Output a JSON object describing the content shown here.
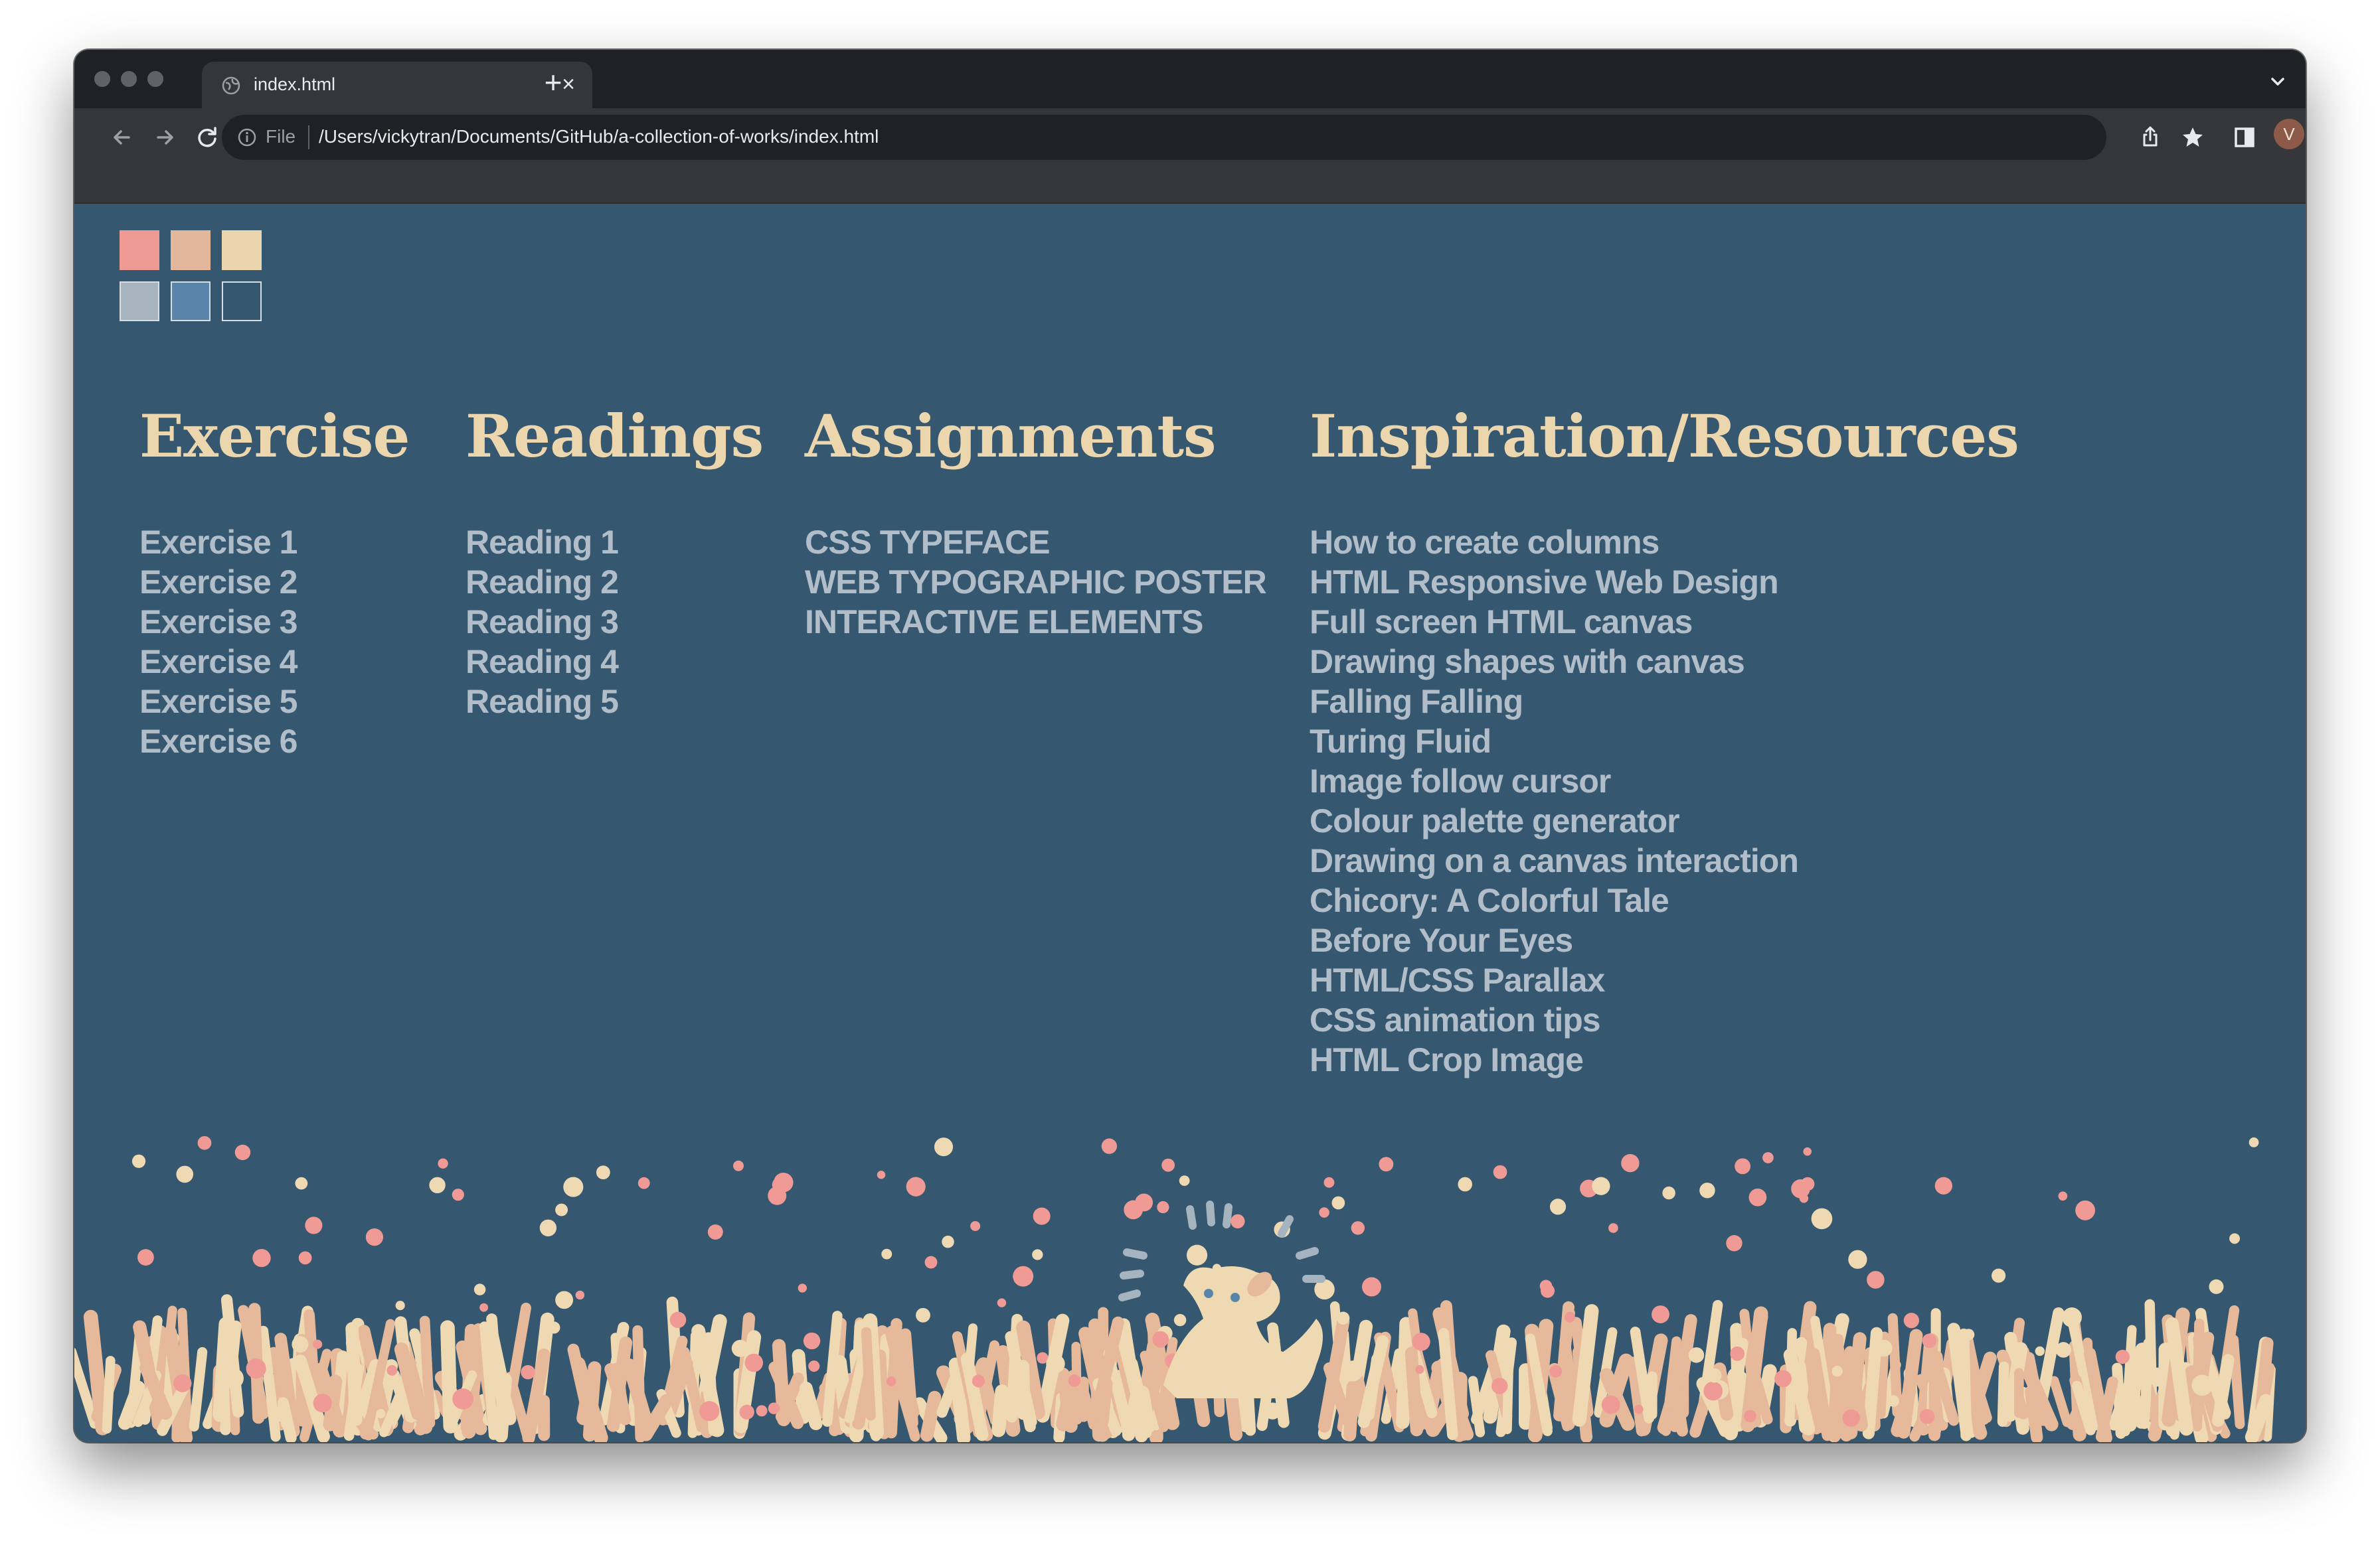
{
  "browser": {
    "tab_title": "index.html",
    "close_glyph": "×",
    "new_tab_glyph": "+",
    "omnibox_scheme": "File",
    "omnibox_url": "/Users/vickytran/Documents/GitHub/a-collection-of-works/index.html",
    "avatar_initial": "V",
    "icons": [
      "back-icon",
      "forward-icon",
      "reload-icon",
      "info-icon",
      "share-icon",
      "bookmark-star-icon",
      "side-panel-icon",
      "kebab-menu-icon",
      "tab-list-chevron-icon",
      "globe-icon"
    ]
  },
  "palette": {
    "colors": [
      "#ef9a94",
      "#e2b79c",
      "#ebd5ae",
      "#a6b4bf",
      "#5a85ab",
      "#35576f"
    ]
  },
  "columns": [
    {
      "heading": "Exercise",
      "items": [
        "Exercise 1",
        "Exercise 2",
        "Exercise 3",
        "Exercise 4",
        "Exercise 5",
        "Exercise 6"
      ]
    },
    {
      "heading": "Readings",
      "items": [
        "Reading 1",
        "Reading 2",
        "Reading 3",
        "Reading 4",
        "Reading 5"
      ]
    },
    {
      "heading": "Assignments",
      "items": [
        "CSS TYPEFACE",
        "WEB TYPOGRAPHIC POSTER",
        "INTERACTIVE ELEMENTS"
      ]
    },
    {
      "heading": "Inspiration/Resources",
      "items": [
        "How to create columns",
        "HTML Responsive Web Design",
        "Full screen HTML canvas",
        "Drawing shapes with canvas",
        "Falling Falling",
        "Turing Fluid",
        "Image follow cursor",
        "Colour palette generator",
        "Drawing on a canvas interaction",
        "Chicory: A Colorful Tale",
        "Before Your Eyes",
        "HTML/CSS Parallax",
        "CSS animation tips",
        "HTML Crop Image"
      ]
    }
  ],
  "theme": {
    "page_bg": "#35576f",
    "heading_color": "#ecd6ad",
    "link_color": "#b1bdc8",
    "grass_colors": [
      "#e6b99a",
      "#efd9b2",
      "#ef9a94"
    ]
  }
}
